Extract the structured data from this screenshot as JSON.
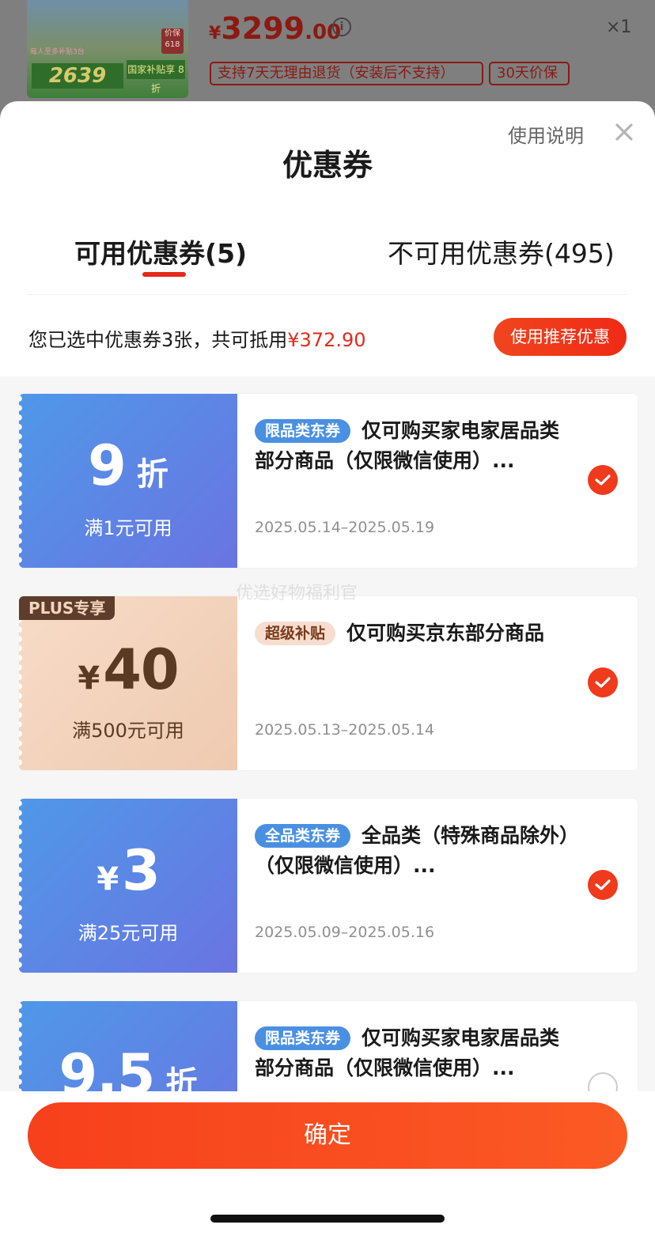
{
  "product": {
    "thumb_badge": "价保\n618",
    "thumb_text_1": "每人至多补贴3台",
    "thumb_price": "2639",
    "thumb_subsidy": "国家补贴享 8折",
    "price_currency": "¥",
    "price_integer": "3299",
    "price_decimal": ".00",
    "quantity": "×1",
    "tags": [
      "支持7天无理由退货（安装后不支持）",
      "30天价保"
    ]
  },
  "sheet": {
    "title": "优惠券",
    "help_label": "使用说明",
    "tabs": [
      {
        "label": "可用优惠券(5)",
        "active": true
      },
      {
        "label": "不可用优惠券(495)",
        "active": false
      }
    ],
    "selected_summary_prefix": "您已选中优惠券3张，共可抵用",
    "selected_amount": "¥372.90",
    "recommend_button": "使用推荐优惠"
  },
  "coupons": [
    {
      "style": "blue",
      "value_num": "9",
      "value_unit": "折",
      "condition": "满1元可用",
      "type_tag": "限品类东券",
      "description": "仅可购买家电家居品类部分商品（仅限微信使用）...",
      "date": "2025.05.14–2025.05.19",
      "checked": true
    },
    {
      "style": "peach",
      "badge": "PLUS专享",
      "value_yen": "¥",
      "value_num": "40",
      "condition": "满500元可用",
      "type_tag": "超级补贴",
      "description": "仅可购买京东部分商品",
      "date": "2025.05.13–2025.05.14",
      "checked": true
    },
    {
      "style": "blue",
      "value_yen": "¥",
      "value_num": "3",
      "condition": "满25元可用",
      "type_tag": "全品类东券",
      "description": "全品类（特殊商品除外）（仅限微信使用）...",
      "date": "2025.05.09–2025.05.16",
      "checked": true
    },
    {
      "style": "blue",
      "value_num": "9.5",
      "value_unit": "折",
      "type_tag": "限品类东券",
      "description": "仅可购买家电家居品类部分商品（仅限微信使用）...",
      "checked": false
    }
  ],
  "watermark": "优选好物福利官",
  "footer": {
    "confirm_button": "确定"
  },
  "colors": {
    "accent": "#e42a1b",
    "coupon_blue": "#5a88e6",
    "coupon_peach": "#f2d2bb"
  }
}
